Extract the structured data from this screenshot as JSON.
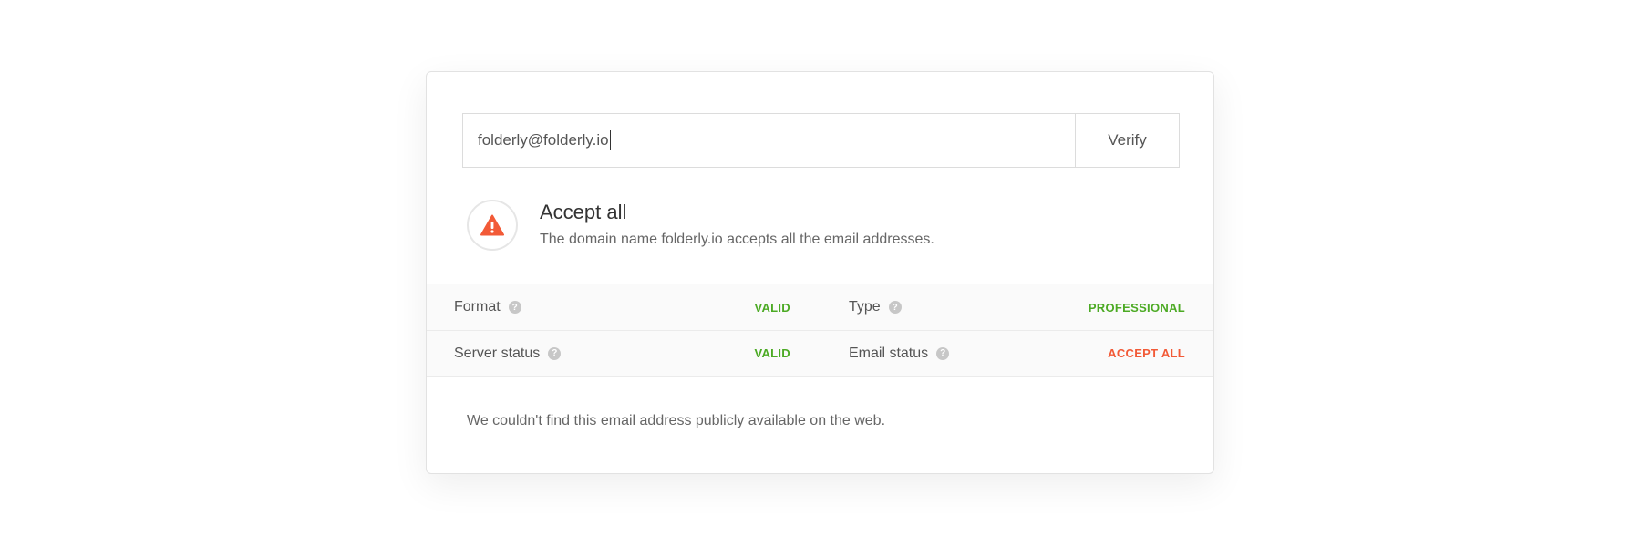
{
  "search": {
    "value": "folderly@folderly.io",
    "verify_label": "Verify"
  },
  "result": {
    "icon": "warning-triangle-icon",
    "title": "Accept all",
    "description": "The domain name folderly.io accepts all the email addresses."
  },
  "details": {
    "format_label": "Format",
    "format_value": "VALID",
    "type_label": "Type",
    "type_value": "PROFESSIONAL",
    "server_status_label": "Server status",
    "server_status_value": "VALID",
    "email_status_label": "Email status",
    "email_status_value": "ACCEPT ALL",
    "help_glyph": "?"
  },
  "footer_note": "We couldn't find this email address publicly available on the web.",
  "colors": {
    "valid": "#4caa24",
    "warning": "#f25a37"
  }
}
